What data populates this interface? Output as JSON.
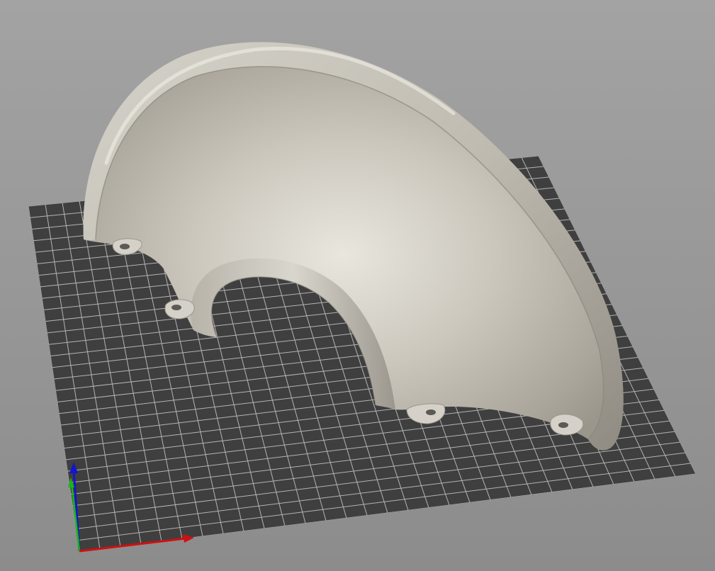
{
  "viewport": {
    "background_top": "#a2a2a2",
    "background_bottom": "#8d8d8d",
    "bed_color": "#3f3f3f",
    "grid_line_color": "#c8c8c8",
    "model_color": "#cfcbc2",
    "model_highlight": "#ebe8e1",
    "model_shadow": "#8e8a82"
  },
  "axes": {
    "x_color": "#e01010",
    "y_color": "#10c010",
    "z_color": "#1010d0"
  },
  "model": {
    "shape": "curved-shell",
    "mouse_ear_count": 4
  }
}
